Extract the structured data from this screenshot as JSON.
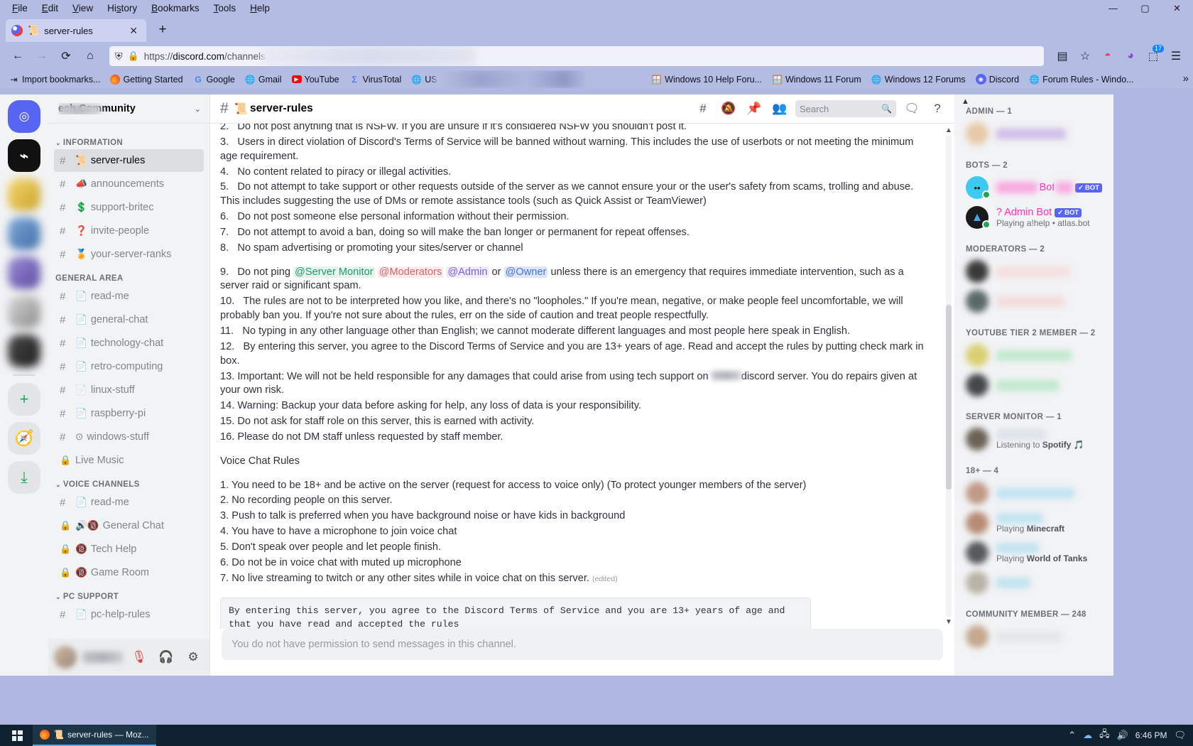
{
  "browser": {
    "menus": [
      "File",
      "Edit",
      "View",
      "History",
      "Bookmarks",
      "Tools",
      "Help"
    ],
    "window_buttons": {
      "minimize": "—",
      "maximize": "▢",
      "close": "✕"
    },
    "tab": {
      "emoji": "📜",
      "title": "server-rules",
      "close": "✕"
    },
    "new_tab": "+",
    "nav": {
      "back": "←",
      "forward": "→",
      "reload": "⟳",
      "home": "⌂"
    },
    "url": {
      "scheme": "https://",
      "host": "discord.com",
      "path": "/channels"
    },
    "toolbar": {
      "reader": "▤",
      "bookmark_star": "☆",
      "pocket": "◑",
      "account": "◕",
      "extensions": "🧩",
      "extension_badge": "17",
      "menu": "☰"
    },
    "bookmarks": [
      {
        "label": "Import bookmarks...",
        "icon": "⇥"
      },
      {
        "label": "Getting Started",
        "icon": "firefox"
      },
      {
        "label": "Google",
        "icon": "G"
      },
      {
        "label": "Gmail",
        "icon": "globe"
      },
      {
        "label": "YouTube",
        "icon": "youtube"
      },
      {
        "label": "VirusTotal",
        "icon": "Σ"
      },
      {
        "label": "US Bank Focus",
        "icon": "globe"
      },
      {
        "label": "Windows 10 Help Foru...",
        "icon": "win"
      },
      {
        "label": "Windows 11 Forum",
        "icon": "win11"
      },
      {
        "label": "Windows 12 Forums",
        "icon": "globe"
      },
      {
        "label": "Discord",
        "icon": "discord"
      },
      {
        "label": "Forum Rules - Windo...",
        "icon": "globe"
      }
    ],
    "bookmarks_overflow": "»"
  },
  "discord": {
    "server": {
      "name_suffix": "ech Community",
      "dropdown": "⌄"
    },
    "channel_groups": [
      {
        "name": "INFORMATION",
        "channels": [
          {
            "emoji": "📜",
            "name": "server-rules",
            "type": "text",
            "active": true
          },
          {
            "emoji": "📣",
            "name": "announcements",
            "type": "text",
            "active": false
          },
          {
            "emoji": "💲",
            "name": "support-britec",
            "type": "text",
            "active": false
          },
          {
            "emoji": "❓",
            "name": "invite-people",
            "type": "text",
            "active": false
          },
          {
            "emoji": "🏅",
            "name": "your-server-ranks",
            "type": "text",
            "active": false
          }
        ]
      },
      {
        "name": "GENERAL AREA",
        "channels": [
          {
            "emoji": "📄",
            "name": "read-me",
            "type": "text",
            "active": false
          },
          {
            "emoji": "📄",
            "name": "general-chat",
            "type": "text",
            "active": false
          },
          {
            "emoji": "📄",
            "name": "technology-chat",
            "type": "text",
            "active": false
          },
          {
            "emoji": "📄",
            "name": "retro-computing",
            "type": "text",
            "active": false
          },
          {
            "emoji": "📄",
            "name": "linux-stuff",
            "type": "text",
            "active": false
          },
          {
            "emoji": "📄",
            "name": "raspberry-pi",
            "type": "text",
            "active": false
          },
          {
            "emoji": "⊙",
            "name": "windows-stuff",
            "type": "text",
            "active": false
          },
          {
            "emoji": "",
            "name": "Live Music",
            "type": "locked",
            "active": false
          }
        ]
      },
      {
        "name": "VOICE CHANNELS",
        "channels": [
          {
            "emoji": "📄",
            "name": "read-me",
            "type": "text",
            "active": false
          },
          {
            "emoji": "🔊🔞",
            "name": "General Chat",
            "type": "locked",
            "active": false
          },
          {
            "emoji": "🔞",
            "name": "Tech Help",
            "type": "locked",
            "active": false
          },
          {
            "emoji": "🔞",
            "name": "Game Room",
            "type": "locked",
            "active": false
          }
        ]
      },
      {
        "name": "PC SUPPORT",
        "channels": [
          {
            "emoji": "📄",
            "name": "pc-help-rules",
            "type": "text",
            "active": false
          }
        ]
      }
    ],
    "user_panel": {
      "mute": "mic-muted-icon",
      "deafen": "headphones-icon",
      "settings": "gear-icon"
    },
    "header": {
      "emoji": "📜",
      "channel": "server-rules",
      "icons": [
        "threads-icon",
        "notification-off-icon",
        "pinned-messages-icon",
        "member-list-icon"
      ],
      "search_placeholder": "Search",
      "inbox": "inbox-icon",
      "help": "help-icon"
    },
    "message": {
      "rules": [
        {
          "num": "2.",
          "text": "Do not post anything that is NSFW. If you are unsure if it's considered NSFW you shouldn't post it."
        },
        {
          "num": "3.",
          "text": "Users in direct violation of Discord's Terms of Service will be banned without warning. This includes the use of userbots or not meeting the minimum age requirement."
        },
        {
          "num": "4.",
          "text": "No content related to piracy or illegal activities."
        },
        {
          "num": "5.",
          "text": "Do not attempt to take support or other requests outside of the server as we cannot ensure your or the user's safety from scams, trolling and abuse. This includes suggesting the use of DMs or remote assistance tools (such as Quick Assist or TeamViewer)"
        },
        {
          "num": "6.",
          "text": "Do not post someone else personal information without their permission."
        },
        {
          "num": "7.",
          "text": "Do not attempt to avoid a ban, doing so will make the ban longer or permanent for repeat offenses."
        },
        {
          "num": "8.",
          "text": "No spam advertising or promoting your sites/server or channel"
        }
      ],
      "rule9": {
        "num": "9.",
        "pre": "Do not ping ",
        "mentions": [
          "@Server Monitor",
          "@Moderators",
          "@Admin"
        ],
        "or": " or ",
        "owner": "@Owner",
        "post": " unless there is an emergency that requires immediate intervention, such as a server raid or significant spam."
      },
      "rules_b": [
        {
          "num": "10.",
          "text": "The rules are not to be interpreted how you like, and there's no \"loopholes.\" If you're mean, negative, or make people feel uncomfortable, we will probably ban you. If you're not sure about the rules, err on the side of caution and treat people respectfully."
        },
        {
          "num": "11.",
          "text": "No typing in any other language other than English; we cannot moderate different languages and most people here speak in English."
        },
        {
          "num": "12.",
          "text": "By entering this server, you agree to the Discord Terms of Service and you are 13+ years of age. Read and accept the rules by putting check mark in box."
        }
      ],
      "rule13_pre": "13. Important: We will not be held responsible for any damages that could arise from using tech support on ",
      "rule13_post": "discord server. You do repairs given at your own risk.",
      "rules_c": [
        "14. Warning: Backup your data before asking for help, any loss of data is your responsibility.",
        "15. Do not ask for staff role on this server, this is earned with activity.",
        "16. Please do not DM staff unless requested by staff member."
      ],
      "voice_heading": "Voice Chat Rules",
      "voice_rules": [
        "1. You need to be 18+ and be active on the server (request for access to voice only) (To protect younger members of the server)",
        "2. No recording people on this server.",
        "3. Push to talk is preferred when you have background noise or have kids in background",
        "4. You have to have a microphone to join voice chat",
        "5. Don't speak over people and let people finish.",
        "6. Do not be in voice chat with muted up microphone"
      ],
      "last_voice_rule": "7. No live streaming to twitch or any other sites while in voice chat on this server.",
      "edited_label": "(edited)",
      "codeblock": "By entering this server, you agree to the Discord Terms of Service and you are 13+ years of age and that you have read and accepted the rules"
    },
    "composer_placeholder": "You do not have permission to send messages in this channel.",
    "member_groups": [
      {
        "label": "ADMIN — 1",
        "members": [
          {
            "name": "",
            "blurred": true,
            "activity": "",
            "bot": false,
            "avatar_color": "#e6c9a8",
            "name_color": "#cdbde8"
          }
        ]
      },
      {
        "label": "BOTS — 2",
        "members": [
          {
            "name": "Bot",
            "blurred": true,
            "activity": "",
            "bot": true,
            "badge": "BOT",
            "avatar_color": "#3ec9f0",
            "name_color": "#f9a8e0"
          },
          {
            "name": "? Admin Bot",
            "blurred": false,
            "activity": "Playing a!help • atlas.bot",
            "bot": true,
            "badge": "BOT",
            "avatar_color": "#1a1a1a",
            "name_color": "#ff2fb8"
          }
        ]
      },
      {
        "label": "MODERATORS — 2",
        "members": [
          {
            "name": "",
            "blurred": true,
            "activity": "",
            "bot": false,
            "avatar_color": "#3a3a3a",
            "name_color": "#f5dede"
          },
          {
            "name": "",
            "blurred": true,
            "activity": "",
            "bot": false,
            "avatar_color": "#5a6a66",
            "name_color": "#f3dada"
          }
        ]
      },
      {
        "label": "YOUTUBE TIER 2 MEMBER — 2",
        "members": [
          {
            "name": "",
            "blurred": true,
            "activity": "",
            "bot": false,
            "avatar_color": "#d9cf72",
            "name_color": "#bfe8cd"
          },
          {
            "name": "",
            "blurred": true,
            "activity": "",
            "bot": false,
            "avatar_color": "#45484b",
            "name_color": "#bfe8cd"
          }
        ]
      },
      {
        "label": "SERVER MONITOR — 1",
        "members": [
          {
            "name": "",
            "blurred": true,
            "activity": "Listening to Spotify",
            "bot": false,
            "avatar_color": "#6b6257",
            "name_color": "#dce3ea"
          }
        ]
      },
      {
        "label": "18+ — 4",
        "members": [
          {
            "name": "",
            "blurred": true,
            "activity": "",
            "bot": false,
            "avatar_color": "#c09a86",
            "name_color": "#bfe3f0"
          },
          {
            "name": "",
            "blurred": true,
            "activity": "Playing Minecraft",
            "bot": false,
            "avatar_color": "#b78b74",
            "name_color": "#bfe3f0"
          },
          {
            "name": "",
            "blurred": true,
            "activity": "Playing World of Tanks",
            "bot": false,
            "avatar_color": "#58595c",
            "name_color": "#bfe3f0"
          },
          {
            "name": "",
            "blurred": true,
            "activity": "",
            "bot": false,
            "avatar_color": "#b9b2a7",
            "name_color": "#bfe3f0"
          }
        ]
      },
      {
        "label": "COMMUNITY MEMBER — 248",
        "members": [
          {
            "name": "",
            "blurred": true,
            "activity": "",
            "bot": false,
            "avatar_color": "#c6a98e",
            "name_color": "#e5e5ea"
          }
        ]
      }
    ]
  },
  "taskbar": {
    "task_title": "server-rules — Moz...",
    "task_emoji": "📜",
    "time": "6:46 PM",
    "tray_icons": [
      "chevron-up-icon",
      "onedrive-icon",
      "network-icon",
      "volume-icon"
    ]
  }
}
